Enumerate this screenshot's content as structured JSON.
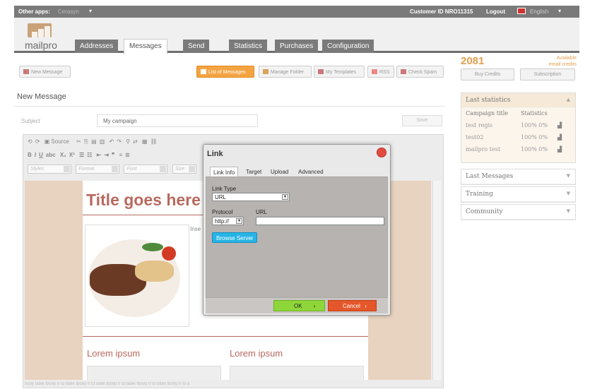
{
  "topbar": {
    "other_apps": "Other apps:",
    "other_apps_value": "Cerasyn",
    "customer_id": "Customer ID NRO11315",
    "logout": "Logout",
    "language": "English"
  },
  "logo": {
    "text": "mailpro"
  },
  "tabs": [
    {
      "label": "Addresses"
    },
    {
      "label": "Messages"
    },
    {
      "label": "Send"
    },
    {
      "label": "Statistics"
    },
    {
      "label": "Purchases"
    },
    {
      "label": "Configuration"
    }
  ],
  "toolbar": {
    "new_message": "New Message",
    "list_messages": "List of Messages",
    "manage_folder": "Manage Folder",
    "my_templates": "My Templates",
    "rss": "RSS",
    "check_spam": "Check Spam"
  },
  "credits": {
    "count": "2081",
    "available": "Available",
    "email_credits": "email credits",
    "buy": "Buy Credits",
    "subscription": "Subscription"
  },
  "page": {
    "title": "New Message",
    "subject_label": "Subject",
    "subject_value": "My campaign",
    "save": "Save"
  },
  "editor": {
    "row1": [
      "Source"
    ],
    "styles": "Styles",
    "format": "Format",
    "font": "Font",
    "size": "Size",
    "statusbar": "body table tbody tr td table tbody tr td table tbody tr td table tbody tr td table tbody tr td a"
  },
  "content": {
    "title": "Title goes here",
    "insert": "Inse",
    "lorem1": "Lorem ipsum",
    "lorem2": "Lorem ipsum"
  },
  "dialog": {
    "title": "Link",
    "tabs": [
      {
        "label": "Link Info"
      },
      {
        "label": "Target"
      },
      {
        "label": "Upload"
      },
      {
        "label": "Advanced"
      }
    ],
    "link_type_label": "Link Type",
    "link_type_value": "URL",
    "protocol_label": "Protocol",
    "protocol_value": "http://",
    "url_label": "URL",
    "browse": "Browse Server",
    "ok": "OK",
    "cancel": "Cancel"
  },
  "sidebar": {
    "last_statistics": "Last statistics",
    "col_campaign": "Campaign title",
    "col_stats": "Statistics",
    "rows": [
      {
        "name": "test regis",
        "pct": "100% 0%"
      },
      {
        "name": "test02",
        "pct": "100% 0%"
      },
      {
        "name": "mailpro test",
        "pct": "100% 0%"
      }
    ],
    "last_messages": "Last Messages",
    "training": "Training",
    "community": "Community"
  }
}
